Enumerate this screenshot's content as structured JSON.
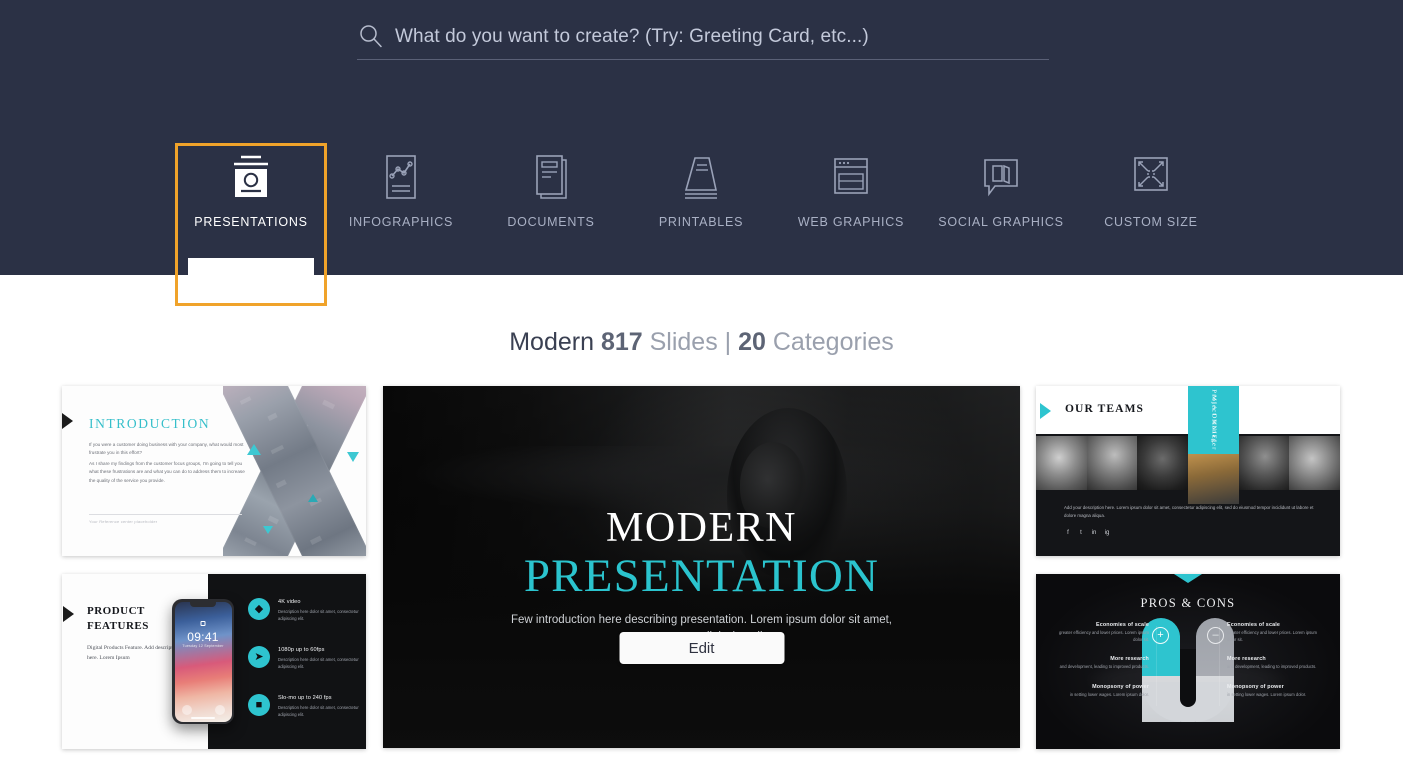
{
  "search": {
    "placeholder": "What do you want to create? (Try: Greeting Card, etc...)",
    "value": "",
    "icon": "search-icon"
  },
  "nav": {
    "active_index": 0,
    "highlight_color": "#f0a32a",
    "items": [
      {
        "label": "PRESENTATIONS",
        "icon": "presentation-board-icon"
      },
      {
        "label": "INFOGRAPHICS",
        "icon": "chart-document-icon"
      },
      {
        "label": "DOCUMENTS",
        "icon": "document-stack-icon"
      },
      {
        "label": "PRINTABLES",
        "icon": "trapezoid-pages-icon"
      },
      {
        "label": "WEB GRAPHICS",
        "icon": "browser-window-icon"
      },
      {
        "label": "SOCIAL GRAPHICS",
        "icon": "speech-bubble-cards-icon"
      },
      {
        "label": "CUSTOM SIZE",
        "icon": "resize-arrows-icon"
      }
    ]
  },
  "gallery": {
    "name": "Modern",
    "slides_count": "817",
    "slides_word": "Slides",
    "separator": "|",
    "categories_count": "20",
    "categories_word": "Categories"
  },
  "main_preview": {
    "title_line1": "MODERN",
    "title_line2": "PRESENTATION",
    "description": "Few introduction here describing presentation. Lorem ipsum dolor sit amet, consectetur adipiscing elit.",
    "edit_label": "Edit",
    "accent_color": "#2bc4ce"
  },
  "thumbnails": {
    "introduction": {
      "title": "INTRODUCTION",
      "paragraph1": "If you were a customer doing business with your company, what would most frustrate you in this effort?",
      "paragraph2": "As I share my findings from the customer focus groups, I'm going to tell you what these frustrations are and what you can do to address them to increase the quality of the service you provide.",
      "footer": "Your Reference center placeholder"
    },
    "product_features": {
      "title": "PRODUCT FEATURES",
      "subtitle": "Digital Products Feature. Add description here. Lorem Ipsum",
      "phone_time": "09:41",
      "phone_date": "Tuesday 12 September",
      "features": [
        {
          "title": "4K video",
          "desc": "Description here dolor sit amet, consectetur adipiscing elit.",
          "icon": "diamond-icon"
        },
        {
          "title": "1080p up to 60fps",
          "desc": "Description here dolor sit amet, consectetur adipiscing elit.",
          "icon": "paper-plane-icon"
        },
        {
          "title": "Slo-mo up to 240 fps",
          "desc": "Description here dolor sit amet, consectetur adipiscing elit.",
          "icon": "gift-icon"
        }
      ]
    },
    "our_teams": {
      "title": "OUR TEAMS",
      "member_name": "MIA DANIEL",
      "member_role": "Project Manager",
      "description": "Add your description here. Lorem ipsum dolor sit amet, consectetur adipiscing elit, sed do eiusmod tempor incididunt ut labore et dolore magna aliqua.",
      "social": [
        "f",
        "t",
        "in",
        "ig"
      ]
    },
    "pros_cons": {
      "title": "PROS & CONS",
      "plus_sign": "+",
      "minus_sign": "–",
      "left_items": [
        {
          "title": "Economies of scale",
          "desc": "greater efficiency and lower prices. Lorem ipsum dolor sit."
        },
        {
          "title": "More research",
          "desc": "and development, leading to improved products."
        },
        {
          "title": "Monopsony of power",
          "desc": "in setting lower wages. Lorem ipsum dolor."
        }
      ],
      "right_items": [
        {
          "title": "Economies of scale",
          "desc": "greater efficiency and lower prices. Lorem ipsum dolor sit."
        },
        {
          "title": "More research",
          "desc": "and development, leading to improved products."
        },
        {
          "title": "Monopsony of power",
          "desc": "in setting lower wages. Lorem ipsum dolor."
        }
      ]
    }
  }
}
